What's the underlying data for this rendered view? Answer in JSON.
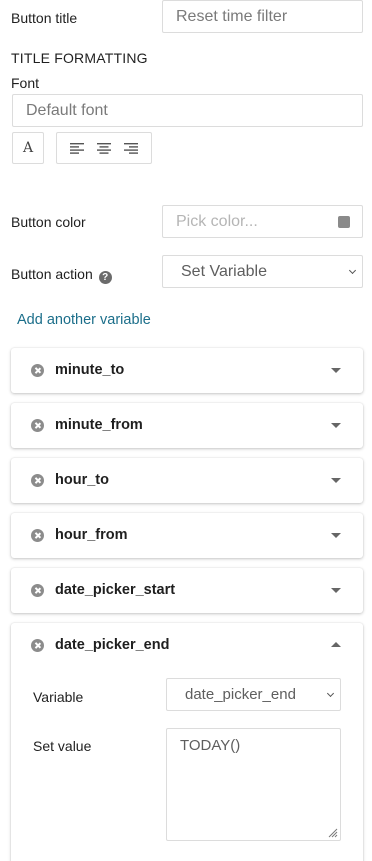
{
  "button_title": {
    "label": "Button title",
    "value": "Reset time filter"
  },
  "title_formatting": {
    "heading": "TITLE FORMATTING",
    "font_label": "Font",
    "font_value": "Default font",
    "font_style_icon": "font-icon",
    "align_icons": [
      "align-left-icon",
      "align-center-icon",
      "align-right-icon"
    ]
  },
  "button_color": {
    "label": "Button color",
    "placeholder": "Pick color...",
    "swatch": "#8a8a8a"
  },
  "button_action": {
    "label": "Button action",
    "help": "?",
    "value": "Set Variable"
  },
  "add_variable_label": "Add another variable",
  "variables": [
    {
      "name": "minute_to",
      "expanded": false
    },
    {
      "name": "minute_from",
      "expanded": false
    },
    {
      "name": "hour_to",
      "expanded": false
    },
    {
      "name": "hour_from",
      "expanded": false
    },
    {
      "name": "date_picker_start",
      "expanded": false
    },
    {
      "name": "date_picker_end",
      "expanded": true
    }
  ],
  "expanded_variable": {
    "variable_label": "Variable",
    "variable_value": "date_picker_end",
    "set_value_label": "Set value",
    "set_value": "TODAY()"
  },
  "colors": {
    "link": "#1b6e8a",
    "border": "#dcdcdc"
  }
}
